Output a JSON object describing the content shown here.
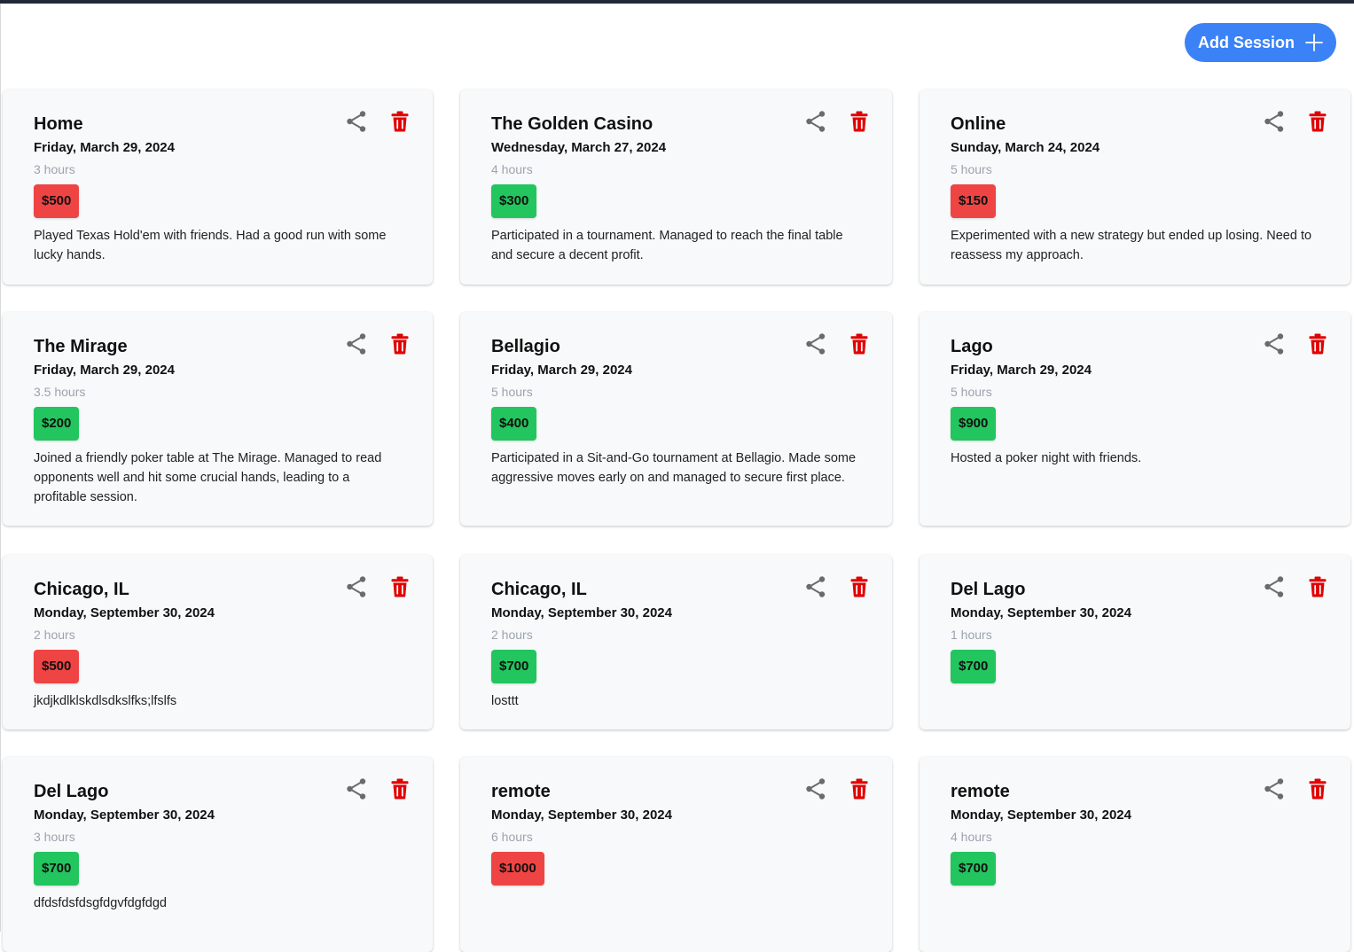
{
  "header": {
    "add_session_label": "Add Session",
    "accent_color": "#3b82f6"
  },
  "colors": {
    "loss": "#ef4444",
    "win": "#22c55e",
    "delete": "#e00000",
    "share": "#6b6b6b"
  },
  "sessions": [
    {
      "location": "Home",
      "date": "Friday, March 29, 2024",
      "duration": "3 hours",
      "amount": "$500",
      "result": "loss",
      "notes": "Played Texas Hold'em with friends. Had a good run with some lucky hands."
    },
    {
      "location": "The Golden Casino",
      "date": "Wednesday, March 27, 2024",
      "duration": "4 hours",
      "amount": "$300",
      "result": "win",
      "notes": "Participated in a tournament. Managed to reach the final table and secure a decent profit."
    },
    {
      "location": "Online",
      "date": "Sunday, March 24, 2024",
      "duration": "5 hours",
      "amount": "$150",
      "result": "loss",
      "notes": "Experimented with a new strategy but ended up losing. Need to reassess my approach."
    },
    {
      "location": "The Mirage",
      "date": "Friday, March 29, 2024",
      "duration": "3.5 hours",
      "amount": "$200",
      "result": "win",
      "notes": "Joined a friendly poker table at The Mirage. Managed to read opponents well and hit some crucial hands, leading to a profitable session."
    },
    {
      "location": "Bellagio",
      "date": "Friday, March 29, 2024",
      "duration": "5 hours",
      "amount": "$400",
      "result": "win",
      "notes": "Participated in a Sit-and-Go tournament at Bellagio. Made some aggressive moves early on and managed to secure first place."
    },
    {
      "location": "Lago",
      "date": "Friday, March 29, 2024",
      "duration": "5 hours",
      "amount": "$900",
      "result": "win",
      "notes": "Hosted a poker night with friends."
    },
    {
      "location": "Chicago, IL",
      "date": "Monday, September 30, 2024",
      "duration": "2 hours",
      "amount": "$500",
      "result": "loss",
      "notes": "jkdjkdlklskdlsdkslfks;lfslfs"
    },
    {
      "location": "Chicago, IL",
      "date": "Monday, September 30, 2024",
      "duration": "2 hours",
      "amount": "$700",
      "result": "win",
      "notes": "losttt"
    },
    {
      "location": "Del Lago",
      "date": "Monday, September 30, 2024",
      "duration": "1 hours",
      "amount": "$700",
      "result": "win",
      "notes": ""
    },
    {
      "location": "Del Lago",
      "date": "Monday, September 30, 2024",
      "duration": "3 hours",
      "amount": "$700",
      "result": "win",
      "notes": "dfdsfdsfdsgfdgvfdgfdgd"
    },
    {
      "location": "remote",
      "date": "Monday, September 30, 2024",
      "duration": "6 hours",
      "amount": "$1000",
      "result": "loss",
      "notes": ""
    },
    {
      "location": "remote",
      "date": "Monday, September 30, 2024",
      "duration": "4 hours",
      "amount": "$700",
      "result": "win",
      "notes": ""
    }
  ]
}
